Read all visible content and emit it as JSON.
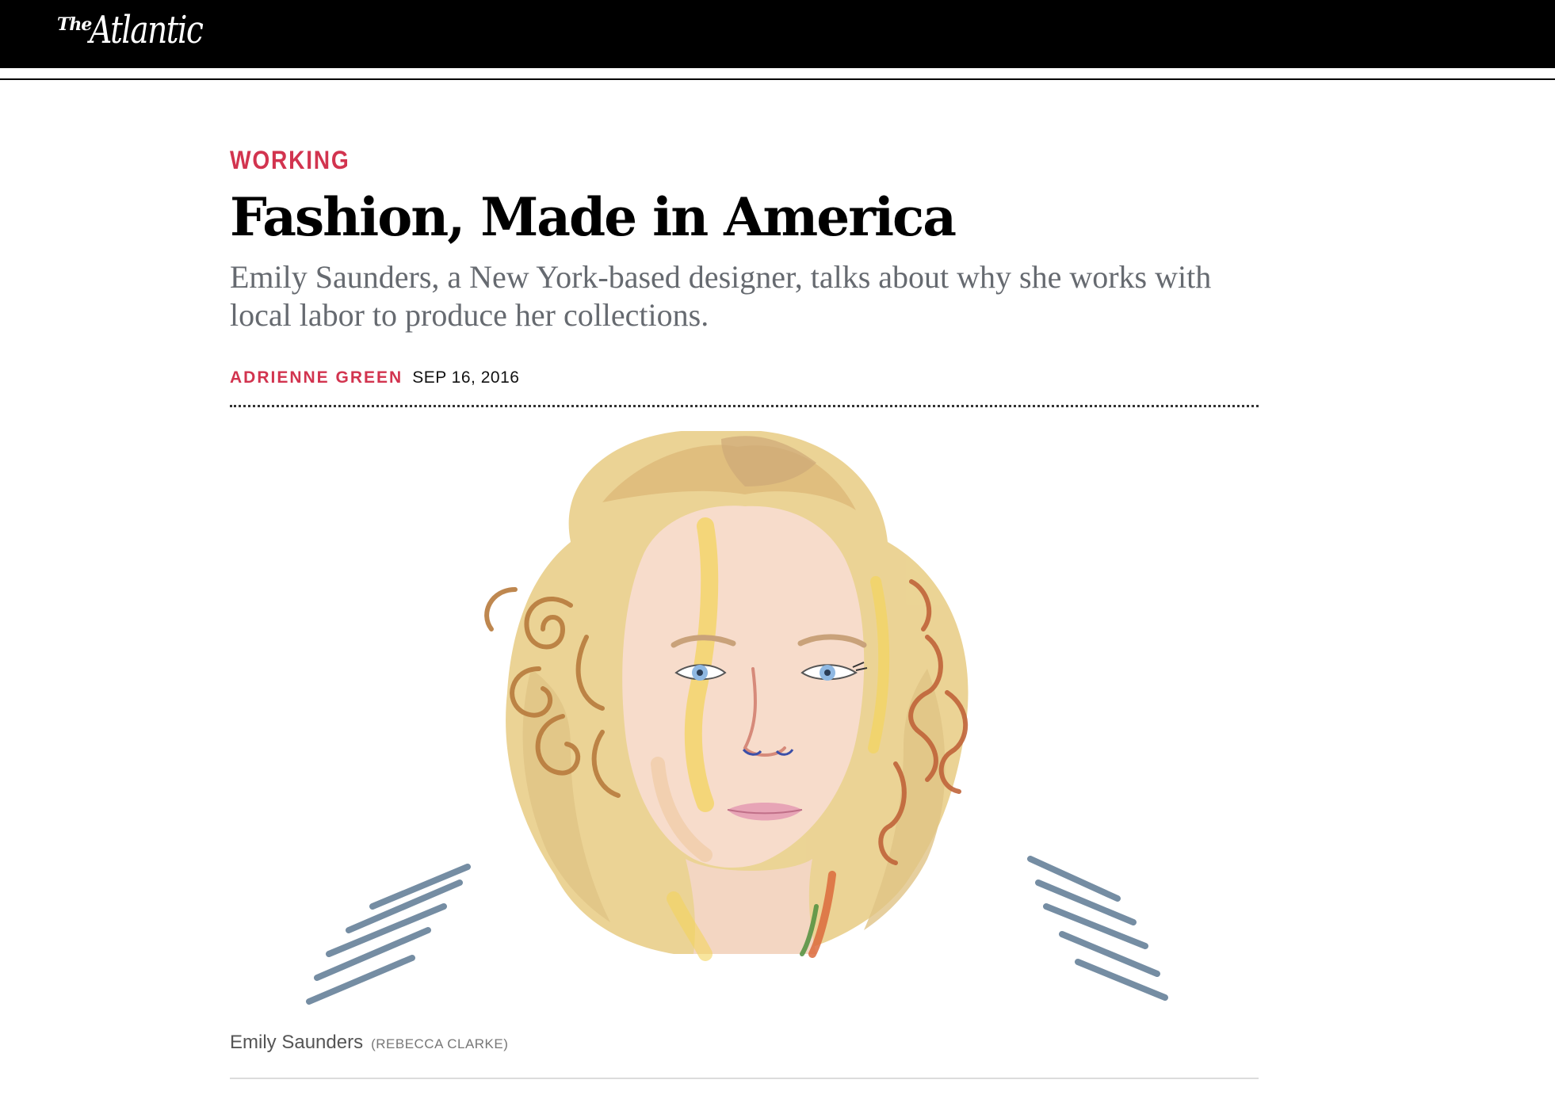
{
  "brand": {
    "logo_prefix": "The",
    "logo_name": "Atlantic"
  },
  "article": {
    "section": "WORKING",
    "headline": "Fashion, Made in America",
    "dek": "Emily Saunders, a New York-based designer, talks about why she works with local labor to produce her collections.",
    "author": "ADRIENNE GREEN",
    "date": "SEP 16, 2016"
  },
  "figure": {
    "caption": "Emily Saunders",
    "credit": "(REBECCA CLARKE)",
    "illustration_subject": "portrait-illustration"
  },
  "colors": {
    "accent": "#d2344f",
    "header_bg": "#000000",
    "dek_text": "#666a70"
  }
}
